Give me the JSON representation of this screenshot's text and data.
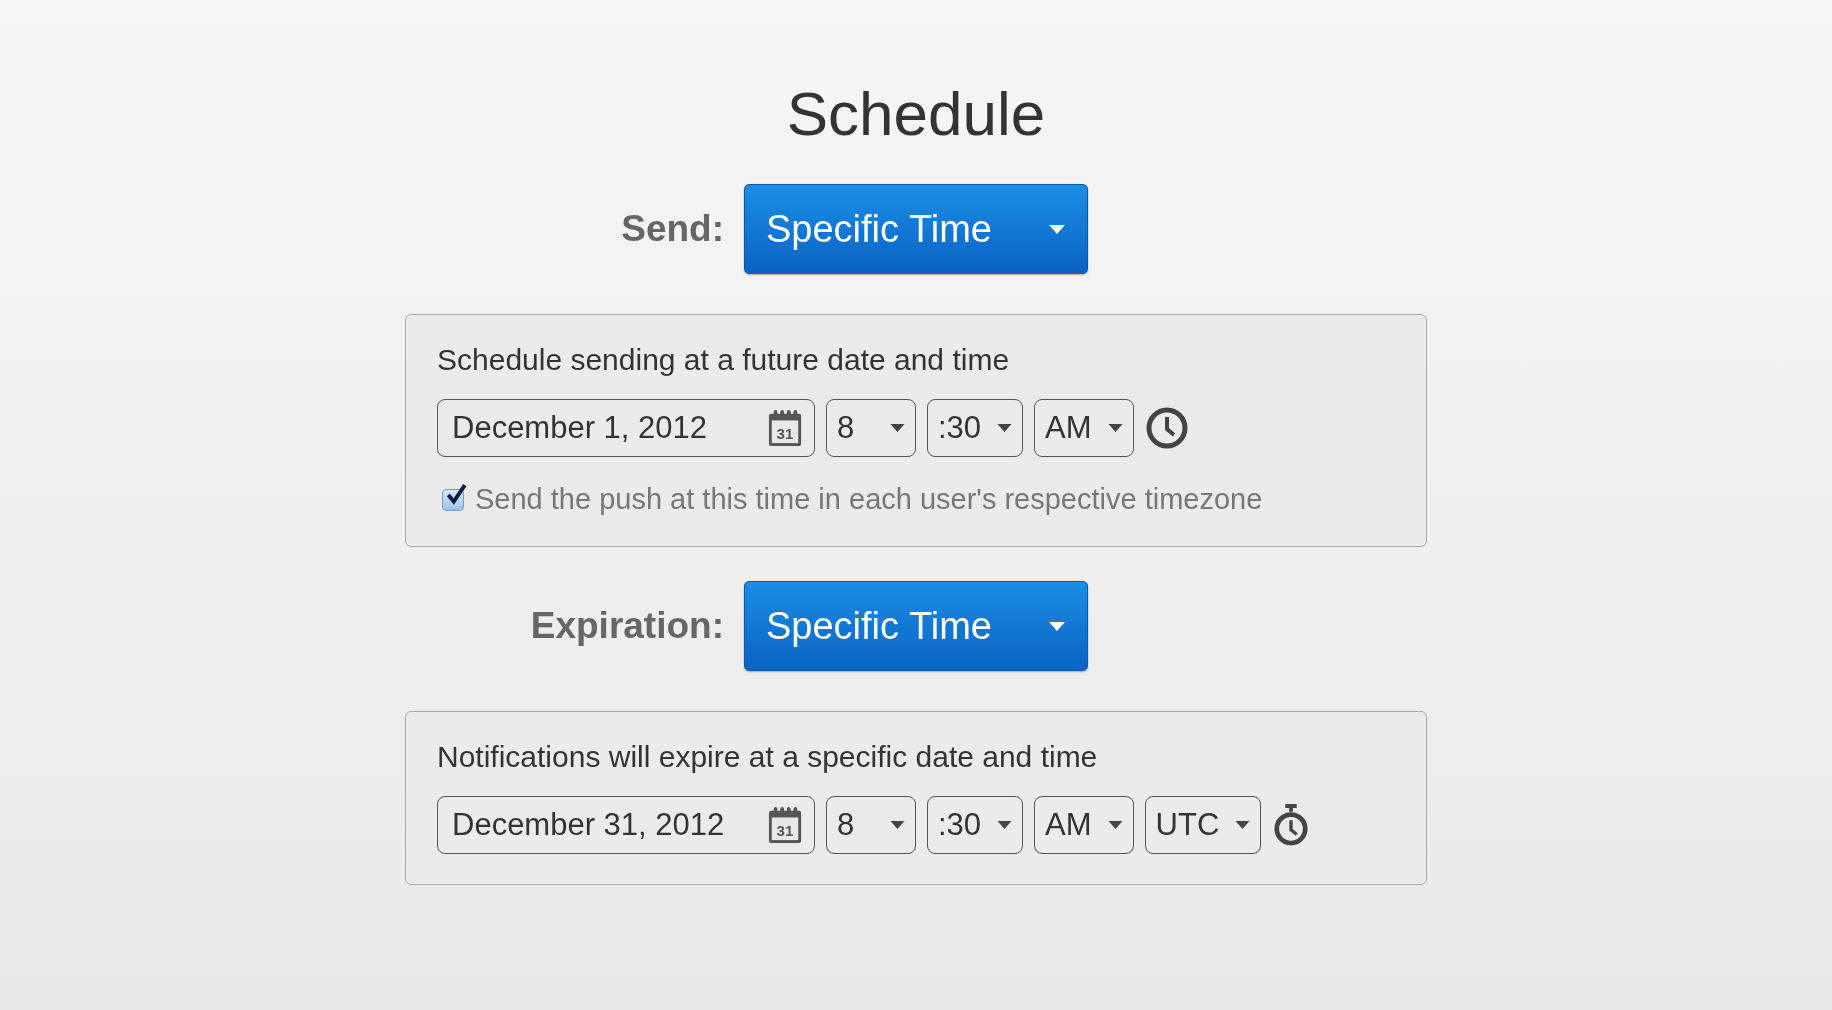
{
  "title": "Schedule",
  "sections": [
    {
      "label": "Send:",
      "dropdown": "Specific Time",
      "panel": {
        "description": "Schedule sending at a future date and time",
        "date": "December 1, 2012",
        "calendar_day": "31",
        "hour": "8",
        "minute": ":30",
        "ampm": "AM",
        "checkbox": {
          "label": "Send the push at this time in each user's respective timezone",
          "checked": true
        }
      }
    },
    {
      "label": "Expiration:",
      "dropdown": "Specific Time",
      "panel": {
        "description": "Notifications will expire at a specific date and time",
        "date": "December 31, 2012",
        "calendar_day": "31",
        "hour": "8",
        "minute": ":30",
        "ampm": "AM",
        "timezone": "UTC"
      }
    }
  ]
}
